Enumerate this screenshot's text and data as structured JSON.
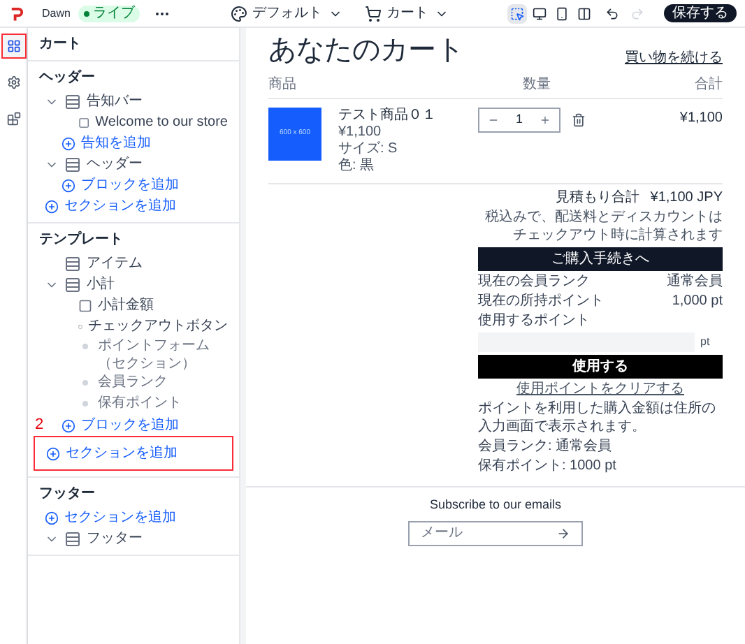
{
  "topbar": {
    "theme_name": "Dawn",
    "status_badge": "ライブ",
    "template_select": "デフォルト",
    "page_select": "カート",
    "view_modes": [
      {
        "selected": true
      },
      {
        "selected": false
      },
      {
        "selected": false
      },
      {
        "selected": false
      }
    ],
    "redo_disabled": true,
    "save_button": "保存する"
  },
  "rail": [
    {
      "selected": true,
      "annotated": true
    },
    {
      "selected": false,
      "annotated": false
    },
    {
      "selected": false,
      "annotated": false
    }
  ],
  "sidebar": {
    "title": "カート",
    "groups": [
      {
        "heading": "ヘッダー",
        "items": [
          {
            "kind": "section",
            "label": "告知バー",
            "expanded": true,
            "children": [
              {
                "kind": "block",
                "label": "Welcome to our store"
              },
              {
                "kind": "add",
                "label": "告知を追加"
              }
            ]
          },
          {
            "kind": "section",
            "label": "ヘッダー",
            "expanded": true,
            "children": [
              {
                "kind": "add",
                "label": "ブロックを追加"
              }
            ]
          },
          {
            "kind": "add",
            "label": "セクションを追加"
          }
        ]
      },
      {
        "heading": "テンプレート",
        "items": [
          {
            "kind": "section",
            "label": "アイテム",
            "expanded": false
          },
          {
            "kind": "section",
            "label": "小計",
            "expanded": true,
            "children": [
              {
                "kind": "block",
                "label": "小計金額"
              },
              {
                "kind": "block",
                "label": "チェックアウトボタン"
              },
              {
                "kind": "app_block",
                "label": "ポイントフォーム（セクション）"
              },
              {
                "kind": "app_block",
                "label": "会員ランク"
              },
              {
                "kind": "app_block",
                "label": "保有ポイント"
              },
              {
                "kind": "add",
                "label": "ブロックを追加"
              }
            ]
          },
          {
            "kind": "add",
            "label": "セクションを追加",
            "annotation": "2"
          }
        ]
      },
      {
        "heading": "フッター",
        "items": [
          {
            "kind": "add",
            "label": "セクションを追加"
          },
          {
            "kind": "section",
            "label": "フッター",
            "expanded": true
          }
        ]
      }
    ]
  },
  "cart": {
    "title": "あなたのカート",
    "continue_link": "買い物を続ける",
    "columns": [
      "商品",
      "数量",
      "合計"
    ],
    "items": [
      {
        "name": "テスト商品０１",
        "image_label": "600 x 600",
        "price": "¥1,100",
        "options": [
          "サイズ: S",
          "色: 黒"
        ],
        "quantity": "1",
        "total": "¥1,100"
      }
    ],
    "summary": {
      "estimated_total_label": "見積もり合計",
      "estimated_total": "¥1,100 JPY",
      "tax_note": "税込みで、配送料とディスカウントはチェックアウト時に計算されます",
      "checkout_button": "ご購入手続きへ",
      "points_rows": [
        {
          "label": "現在の会員ランク",
          "value": "通常会員"
        },
        {
          "label": "現在の所持ポイント",
          "value": "1,000 pt"
        }
      ],
      "use_points_label": "使用するポイント",
      "points_unit": "pt",
      "apply_button": "使用する",
      "clear_link": "使用ポイントをクリアする",
      "notice": "ポイントを利用した購入金額は住所の入力画面で表示されます。",
      "member_rank": "会員ランク: 通常会員",
      "held_points": "保有ポイント: 1000 pt"
    }
  },
  "newsletter": {
    "title": "Subscribe to our emails",
    "email_placeholder": "メール"
  }
}
